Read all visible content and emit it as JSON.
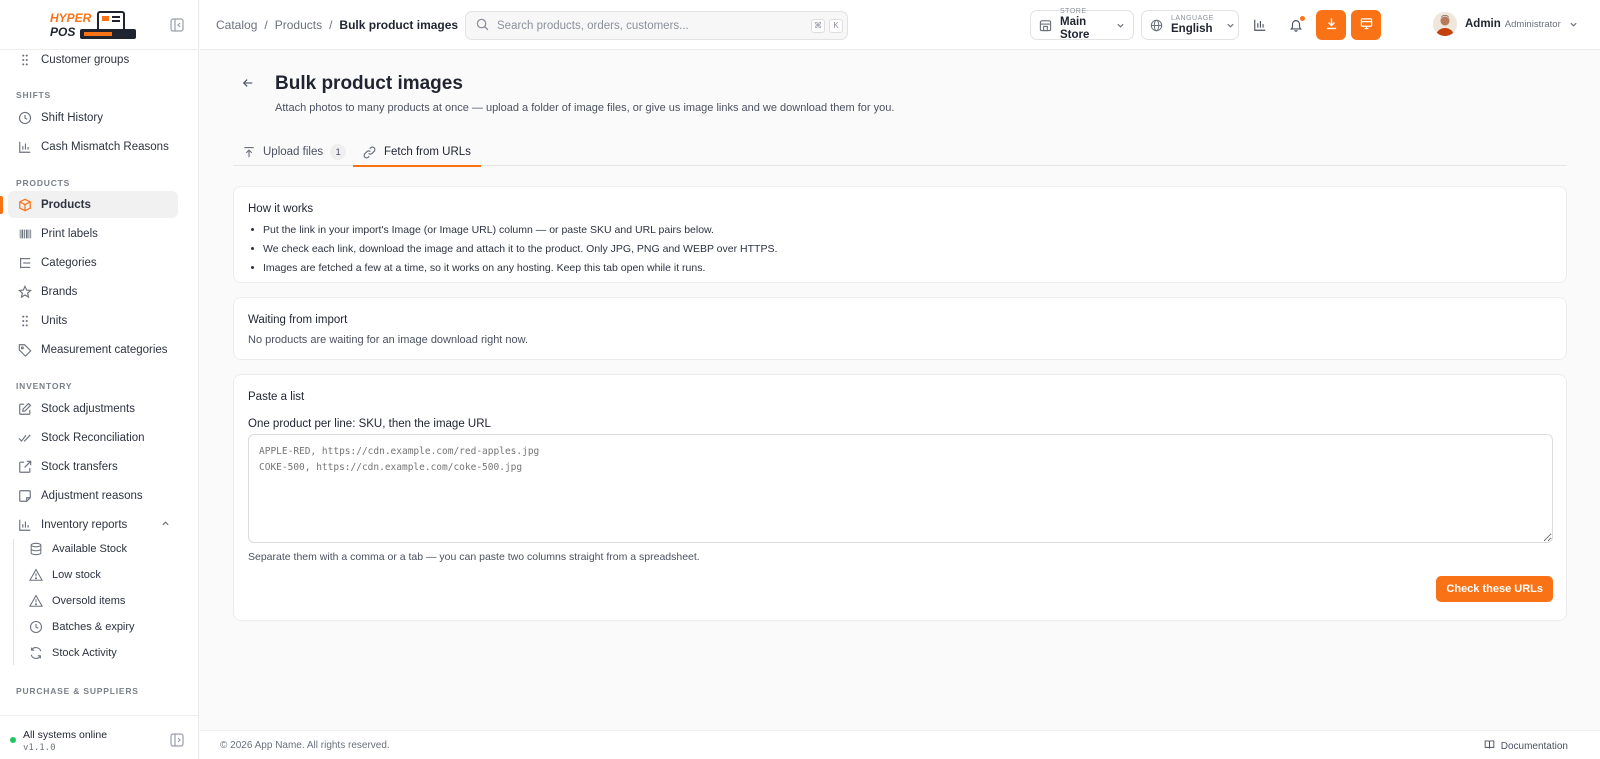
{
  "brand": {
    "logo_line1": "HYPER",
    "logo_line2": "POS"
  },
  "sidebar": {
    "top_item": {
      "label": "Customer groups",
      "icon": "grip-icon"
    },
    "sections": {
      "shifts": "SHIFTS",
      "products": "PRODUCTS",
      "inventory": "INVENTORY",
      "purchase": "PURCHASE & SUPPLIERS"
    },
    "shift_items": [
      {
        "label": "Shift History",
        "icon": "clock-icon"
      },
      {
        "label": "Cash Mismatch Reasons",
        "icon": "bar-chart-icon"
      }
    ],
    "product_items": [
      {
        "label": "Products",
        "icon": "box-icon",
        "active": true
      },
      {
        "label": "Print labels",
        "icon": "barcode-icon"
      },
      {
        "label": "Categories",
        "icon": "tree-icon"
      },
      {
        "label": "Brands",
        "icon": "star-icon"
      },
      {
        "label": "Units",
        "icon": "grip-icon"
      },
      {
        "label": "Measurement categories",
        "icon": "tag-icon"
      }
    ],
    "inventory_items": [
      {
        "label": "Stock adjustments",
        "icon": "edit-icon"
      },
      {
        "label": "Stock Reconciliation",
        "icon": "double-check-icon"
      },
      {
        "label": "Stock transfers",
        "icon": "external-link-icon"
      },
      {
        "label": "Adjustment reasons",
        "icon": "note-icon"
      },
      {
        "label": "Inventory reports",
        "icon": "bar-chart-icon",
        "expanded": true
      }
    ],
    "report_items": [
      {
        "label": "Available Stock",
        "icon": "database-icon"
      },
      {
        "label": "Low stock",
        "icon": "warning-icon"
      },
      {
        "label": "Oversold items",
        "icon": "warning-icon"
      },
      {
        "label": "Batches & expiry",
        "icon": "clock-icon"
      },
      {
        "label": "Stock Activity",
        "icon": "refresh-icon"
      }
    ],
    "footer": {
      "status": "All systems online",
      "version": "v1.1.0",
      "status_color": "#22c55e"
    }
  },
  "header": {
    "breadcrumb": [
      "Catalog",
      "Products",
      "Bulk product images"
    ],
    "search_placeholder": "Search products, orders, customers...",
    "shortcut_keys": [
      "⌘",
      "K"
    ],
    "store": {
      "caption": "STORE",
      "value": "Main Store"
    },
    "language": {
      "caption": "LANGUAGE",
      "value": "English"
    },
    "user": {
      "name": "Admin",
      "role": "Administrator"
    },
    "accent_color": "#f97316"
  },
  "page": {
    "title": "Bulk product images",
    "subtitle": "Attach photos to many products at once — upload a folder of image files, or give us image links and we download them for you.",
    "tabs": [
      {
        "label": "Upload files",
        "count": "1",
        "icon": "upload-icon"
      },
      {
        "label": "Fetch from URLs",
        "icon": "link-icon",
        "active": true
      }
    ],
    "how_it_works": {
      "title": "How it works",
      "points": [
        "Put the link in your import's Image (or Image URL) column — or paste SKU and URL pairs below.",
        "We check each link, download the image and attach it to the product. Only JPG, PNG and WEBP over HTTPS.",
        "Images are fetched a few at a time, so it works on any hosting. Keep this tab open while it runs."
      ]
    },
    "waiting": {
      "title": "Waiting from import",
      "message": "No products are waiting for an image download right now."
    },
    "paste": {
      "title": "Paste a list",
      "field_label": "One product per line: SKU, then the image URL",
      "placeholder": "APPLE-RED, https://cdn.example.com/red-apples.jpg\nCOKE-500, https://cdn.example.com/coke-500.jpg",
      "helper": "Separate them with a comma or a tab — you can paste two columns straight from a spreadsheet.",
      "button": "Check these URLs"
    }
  },
  "footer": {
    "copyright": "© 2026 App Name. All rights reserved.",
    "docs": "Documentation"
  }
}
